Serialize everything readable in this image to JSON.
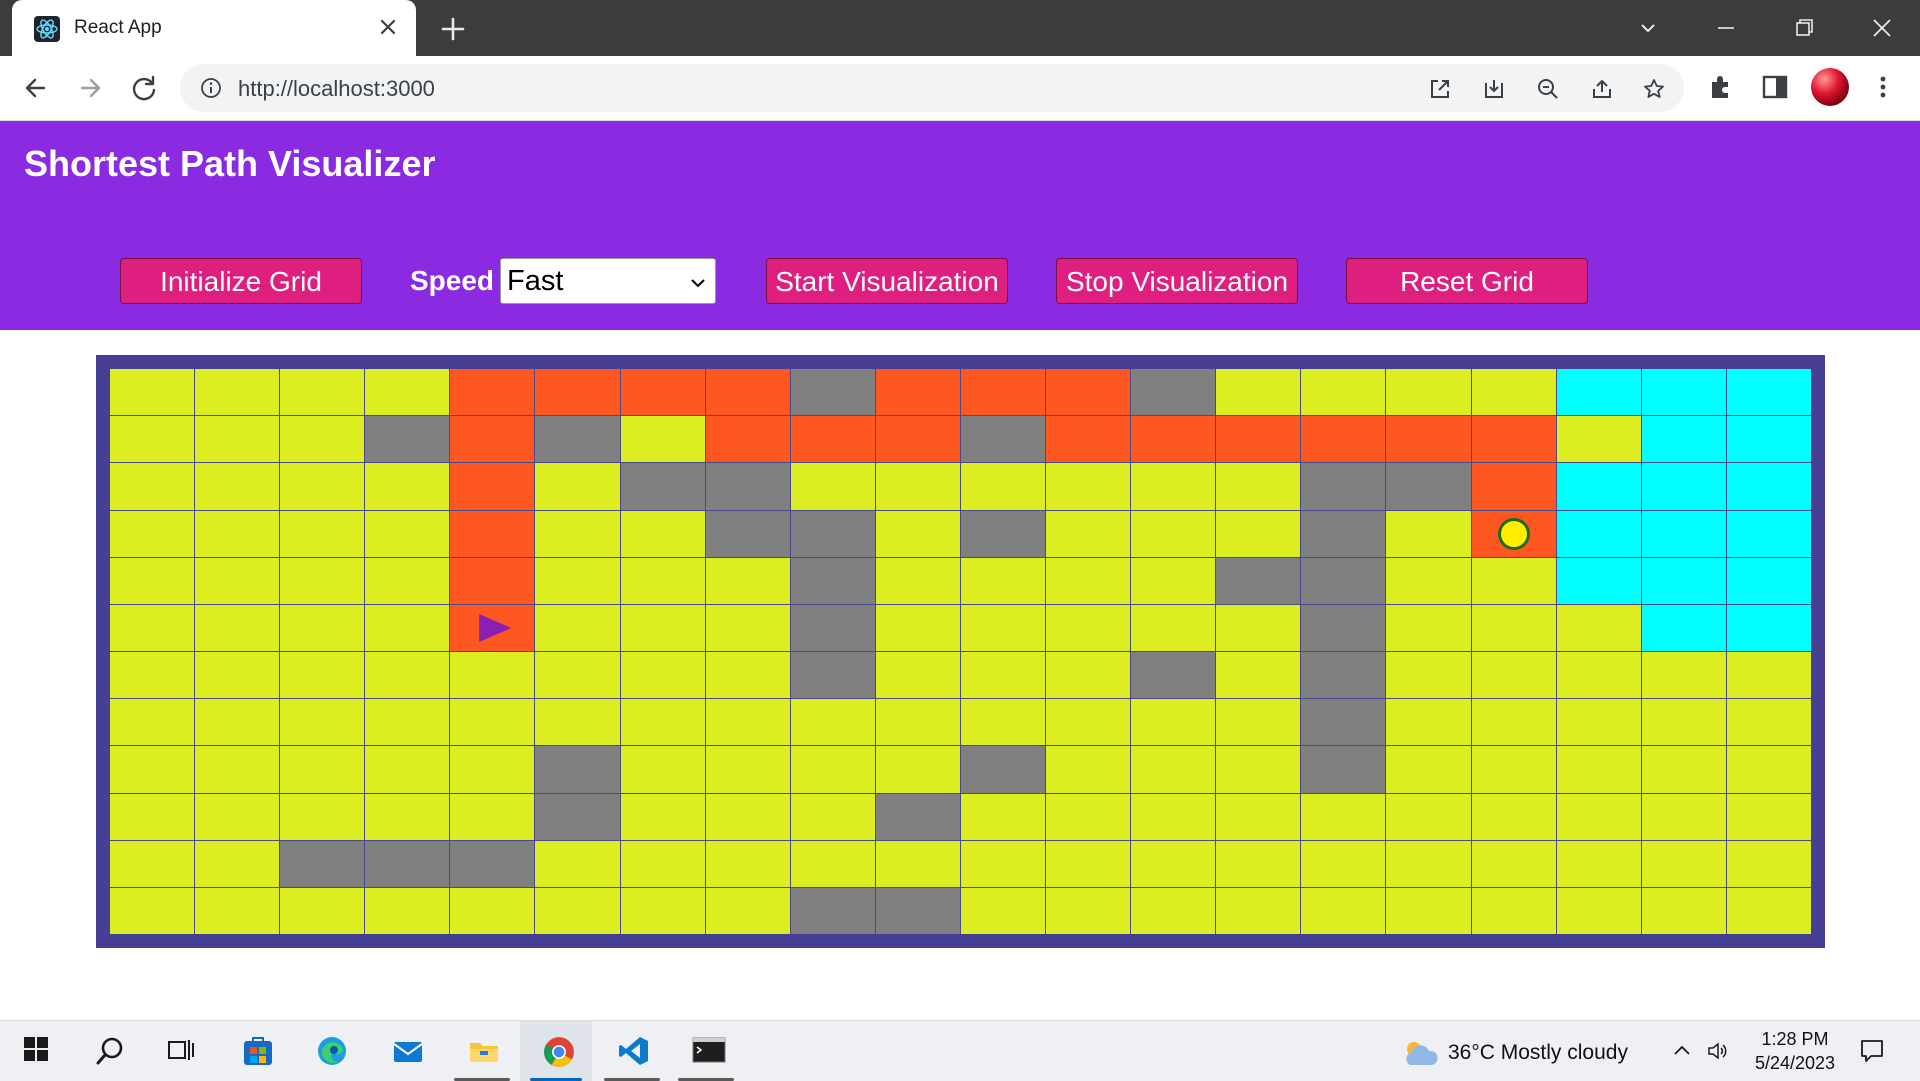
{
  "browser": {
    "tab_title": "React App",
    "url": "http://localhost:3000"
  },
  "app": {
    "title": "Shortest Path Visualizer",
    "buttons": {
      "initialize": "Initialize Grid",
      "start": "Start Visualization",
      "stop": "Stop Visualization",
      "reset": "Reset Grid"
    },
    "speed_label": "Speed",
    "speed_value": "Fast"
  },
  "grid": {
    "rows": 12,
    "cols": 20,
    "legend": {
      "Y": "#dced22",
      "W": "#808080",
      "O": "#ff5722",
      "C": "#00ffff"
    },
    "cells": [
      "YYYYOOOOWOOOWYYYYCCC",
      "YYYWOWYOOOWOOOOOOYCC",
      "YYYYOYWWYYYYYYWWOCCC",
      "YYYYOYYWWYWYYYWYOCCC",
      "YYYYOYYYWYYYYWWYYCCC",
      "YYYYOYYYWYYYYYWYYYCC",
      "YYYYYYYYWYYYWYWYYYYY",
      "YYYYYYYYYYYYYYWYYYYY",
      "YYYYYWYYYYWYYYWYYYYY",
      "YYYYYWYYYWYYYYYYYYYY",
      "YYWWWYYYYYYYYYYYYYYY",
      "YYYYYYYYWWYYYYYYYYYY"
    ],
    "start": {
      "row": 5,
      "col": 4,
      "label": "start-node"
    },
    "end": {
      "row": 3,
      "col": 16,
      "label": "end-node"
    }
  },
  "taskbar": {
    "weather": "36°C  Mostly cloudy",
    "time": "1:28 PM",
    "date": "5/24/2023",
    "apps": [
      "start-icon",
      "search-icon",
      "task-view-icon",
      "microsoft-store-icon",
      "edge-icon",
      "mail-icon",
      "file-explorer-icon",
      "chrome-icon",
      "vscode-icon",
      "terminal-icon"
    ]
  }
}
